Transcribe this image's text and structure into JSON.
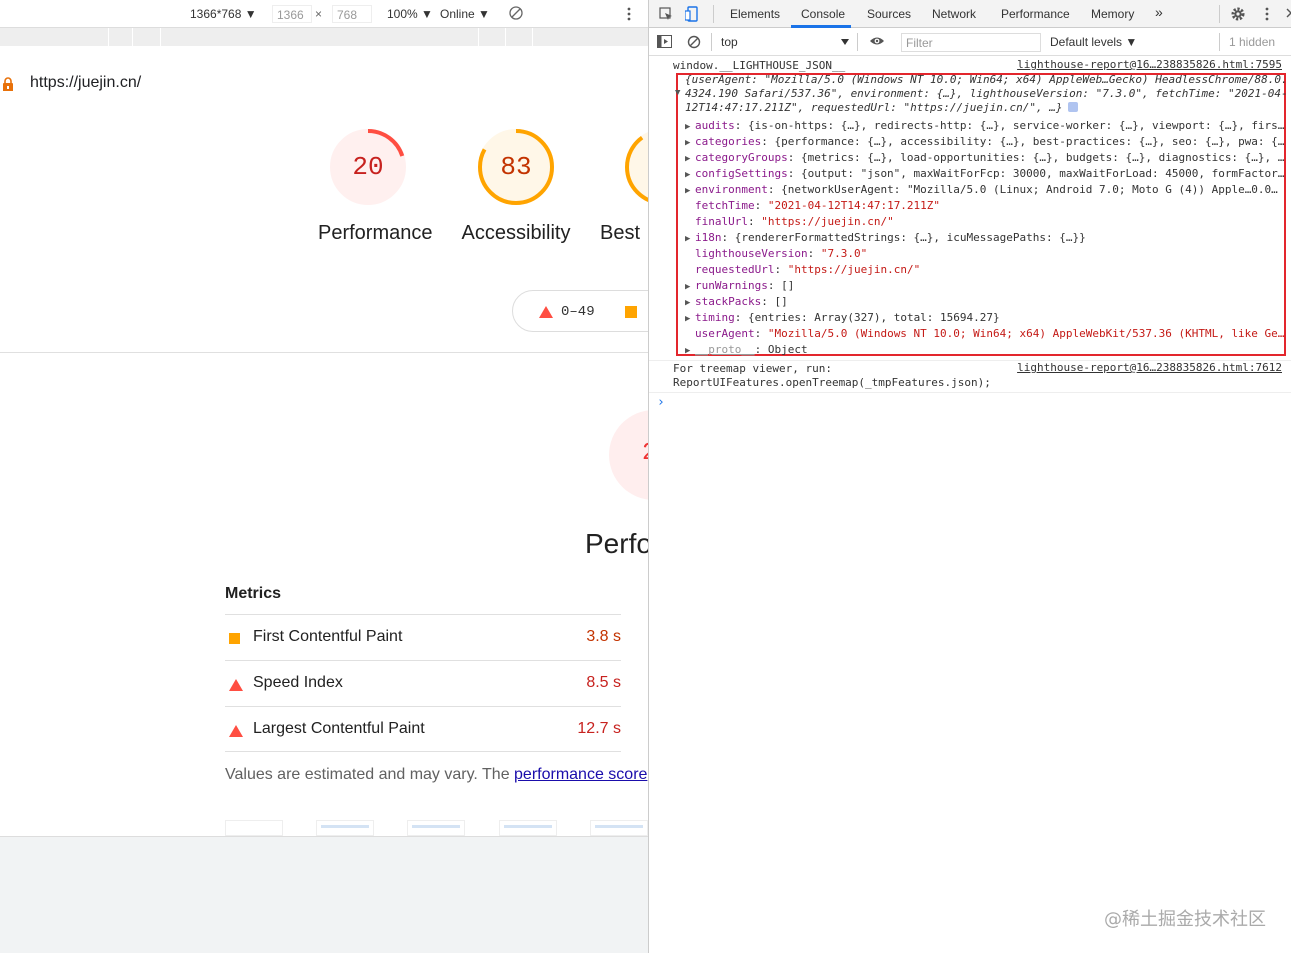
{
  "device_toolbar": {
    "dimensions_preset": "1366*768 ▼",
    "width": "1366",
    "times": "×",
    "height": "768",
    "zoom": "100% ▼",
    "throttle": "Online ▼"
  },
  "page": {
    "url": "https://juejin.cn/",
    "gauges": [
      {
        "score": "20",
        "label": "Performance",
        "fraction": 0.2,
        "color": "#ff4e42",
        "bg": "#fff0ef"
      },
      {
        "score": "83",
        "label": "Accessibility",
        "fraction": 0.83,
        "color": "#ffa400",
        "bg": "#fff7e8"
      },
      {
        "score": "",
        "label": "Best",
        "fraction": 0.9,
        "color": "#ffa400",
        "bg": "#fff7e8"
      }
    ],
    "legend_range": "0–49",
    "big_gauge_score": "2",
    "perf_title": "Perfo",
    "metrics_title": "Metrics",
    "metrics": [
      {
        "name": "First Contentful Paint",
        "value": "3.8 s",
        "status": "average",
        "color": "#c33300"
      },
      {
        "name": "Speed Index",
        "value": "8.5 s",
        "status": "fail",
        "color": "#c7221f"
      },
      {
        "name": "Largest Contentful Paint",
        "value": "12.7 s",
        "status": "fail",
        "color": "#c7221f"
      }
    ],
    "estimate_text": "Values are estimated and may vary. The ",
    "estimate_link": "performance score"
  },
  "devtools": {
    "tabs": [
      "Elements",
      "Console",
      "Sources",
      "Network",
      "Performance",
      "Memory",
      "»"
    ],
    "active_tab": "Console",
    "context": "top",
    "filter_placeholder": "Filter",
    "levels": "Default levels ▼",
    "hidden_count": "1 hidden",
    "console": {
      "header_expr": "window.__LIGHTHOUSE_JSON__",
      "header_src": "lighthouse-report@16…238835826.html:7595",
      "summary_1": "{userAgent: \"Mozilla/5.0 (Windows NT 10.0; Win64; x64) AppleWeb…Gecko) HeadlessChrome/88.0.",
      "summary_2": "4324.190 Safari/537.36\", environment: {…}, lighthouseVersion: \"7.3.0\", fetchTime: \"2021-04-",
      "summary_3": "12T14:47:17.211Z\", requestedUrl: \"https://juejin.cn/\", …}",
      "props": [
        {
          "key": "audits",
          "expandable": true,
          "value": "{is-on-https: {…}, redirects-http: {…}, service-worker: {…}, viewport: {…}, firs…"
        },
        {
          "key": "categories",
          "expandable": true,
          "value": "{performance: {…}, accessibility: {…}, best-practices: {…}, seo: {…}, pwa: {…"
        },
        {
          "key": "categoryGroups",
          "expandable": true,
          "value": "{metrics: {…}, load-opportunities: {…}, budgets: {…}, diagnostics: {…}, …"
        },
        {
          "key": "configSettings",
          "expandable": true,
          "value": "{output: \"json\", maxWaitForFcp: 30000, maxWaitForLoad: 45000, formFactor…"
        },
        {
          "key": "environment",
          "expandable": true,
          "value": "{networkUserAgent: \"Mozilla/5.0 (Linux; Android 7.0; Moto G (4)) Apple…0.0…"
        },
        {
          "key": "fetchTime",
          "expandable": false,
          "value": "\"2021-04-12T14:47:17.211Z\""
        },
        {
          "key": "finalUrl",
          "expandable": false,
          "value": "\"https://juejin.cn/\""
        },
        {
          "key": "i18n",
          "expandable": true,
          "value": "{rendererFormattedStrings: {…}, icuMessagePaths: {…}}"
        },
        {
          "key": "lighthouseVersion",
          "expandable": false,
          "value": "\"7.3.0\""
        },
        {
          "key": "requestedUrl",
          "expandable": false,
          "value": "\"https://juejin.cn/\""
        },
        {
          "key": "runWarnings",
          "expandable": true,
          "value": "[]"
        },
        {
          "key": "stackPacks",
          "expandable": true,
          "value": "[]"
        },
        {
          "key": "timing",
          "expandable": true,
          "value": "{entries: Array(327), total: 15694.27}"
        },
        {
          "key": "userAgent",
          "expandable": false,
          "value": "\"Mozilla/5.0 (Windows NT 10.0; Win64; x64) AppleWebKit/537.36 (KHTML, like Ge…"
        },
        {
          "key": "__proto__",
          "expandable": true,
          "value": "Object"
        }
      ],
      "treemap_line_1": "For treemap viewer, run:",
      "treemap_line_2": "ReportUIFeatures.openTreemap(_tmpFeatures.json);",
      "treemap_src": "lighthouse-report@16…238835826.html:7612"
    }
  },
  "watermark": "@稀土掘金技术社区"
}
